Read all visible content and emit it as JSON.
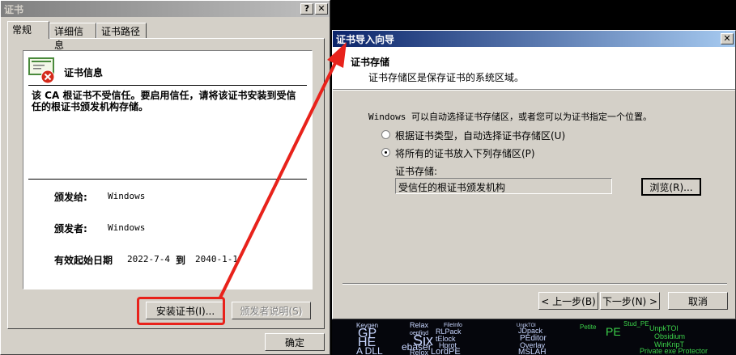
{
  "cert_window": {
    "title": "证书",
    "help_label": "?",
    "close_label": "✕",
    "tabs": [
      "常规",
      "详细信息",
      "证书路径"
    ],
    "info_heading": "证书信息",
    "warning": "该 CA 根证书不受信任。要启用信任，请将该证书安装到受信任的根证书颁发机构存储。",
    "issued_to_label": "颁发给:",
    "issued_to_value": "Windows",
    "issued_by_label": "颁发者:",
    "issued_by_value": "Windows",
    "valid_label": "有效起始日期",
    "valid_from": "2022-7-4",
    "valid_to_label": "到",
    "valid_to": "2040-1-1",
    "install_button": "安装证书(I)...",
    "issuer_statement_button": "颁发者说明(S)",
    "ok_button": "确定"
  },
  "wizard": {
    "title": "证书导入向导",
    "close_label": "✕",
    "heading": "证书存储",
    "subheading": "证书存储区是保存证书的系统区域。",
    "description": "Windows 可以自动选择证书存储区，或者您可以为证书指定一个位置。",
    "radio_auto": "根据证书类型，自动选择证书存储区(U)",
    "radio_manual": "将所有的证书放入下列存储区(P)",
    "store_label": "证书存储:",
    "store_value": "受信任的根证书颁发机构",
    "browse_button": "浏览(R)...",
    "back_button": "< 上一步(B)",
    "next_button": "下一步(N) >",
    "cancel_button": "取消",
    "selected_option": "manual"
  },
  "desktop_words": [
    "Keygen",
    "GP",
    "HE",
    "A DLL",
    "Relax",
    "oepfind",
    "Six",
    "ebaser",
    "Relox",
    "FileInfo",
    "RLPack",
    "tElock",
    "Hprot",
    "LordPE",
    "UnpkTOl",
    "JDpack",
    "PEditor",
    "Overlay",
    "MSLAH",
    "Petite",
    "PE",
    "Stud_PE",
    "UnpkTOl",
    "Obsidium",
    "WinKripT",
    "Private exe Protector"
  ],
  "colors": {
    "highlight": "#e8221b",
    "title_active": "#0a246a",
    "desktop_text": "#3cd24a"
  }
}
